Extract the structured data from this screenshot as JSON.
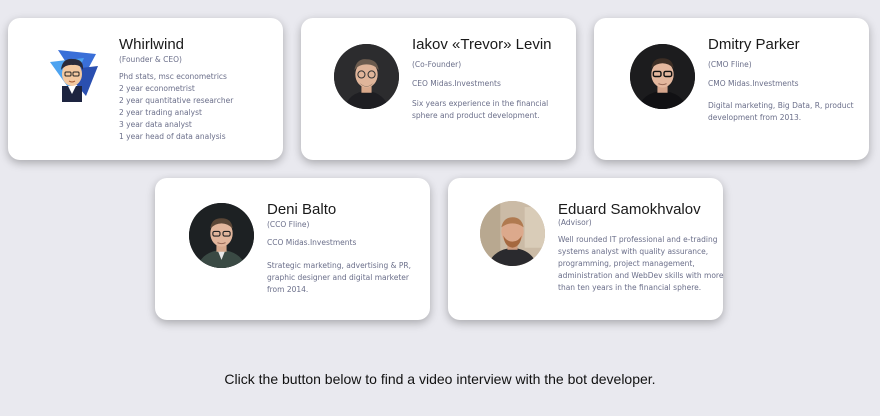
{
  "team": {
    "whirlwind": {
      "name": "Whirlwind",
      "role": "(Founder & CEO)",
      "lines": [
        "Phd stats, msc econometrics",
        "2 year econometrist",
        "2 year quantitative researcher",
        "2 year trading analyst",
        "3 year data analyst",
        "1 year head of data analysis"
      ]
    },
    "iakov": {
      "name": "Iakov «Trevor» Levin",
      "role": "(Co-Founder)",
      "company": "CEO Midas.Investments",
      "lines": [
        "Six years experience in the financial",
        "sphere and product development."
      ]
    },
    "dmitry": {
      "name": "Dmitry Parker",
      "role": "(CMO Fline)",
      "company": "CMO Midas.Investments",
      "lines": [
        "Digital marketing, Big Data, R, product",
        "development from 2013."
      ]
    },
    "deni": {
      "name": "Deni Balto",
      "role": "(CCO Fline)",
      "company": "CCO Midas.Investments",
      "lines": [
        "Strategic marketing, advertising & PR,",
        "graphic designer and digital marketer",
        "from 2014."
      ]
    },
    "eduard": {
      "name": "Eduard Samokhvalov",
      "role": "(Advisor)",
      "lines": [
        "Well rounded IT professional and e-trading",
        "systems analyst with quality assurance,",
        "programming, project management,",
        "administration and WebDev skills with more",
        "than ten years in the financial sphere."
      ]
    }
  },
  "footer_text": "Click the button below to find a video interview with the bot developer."
}
